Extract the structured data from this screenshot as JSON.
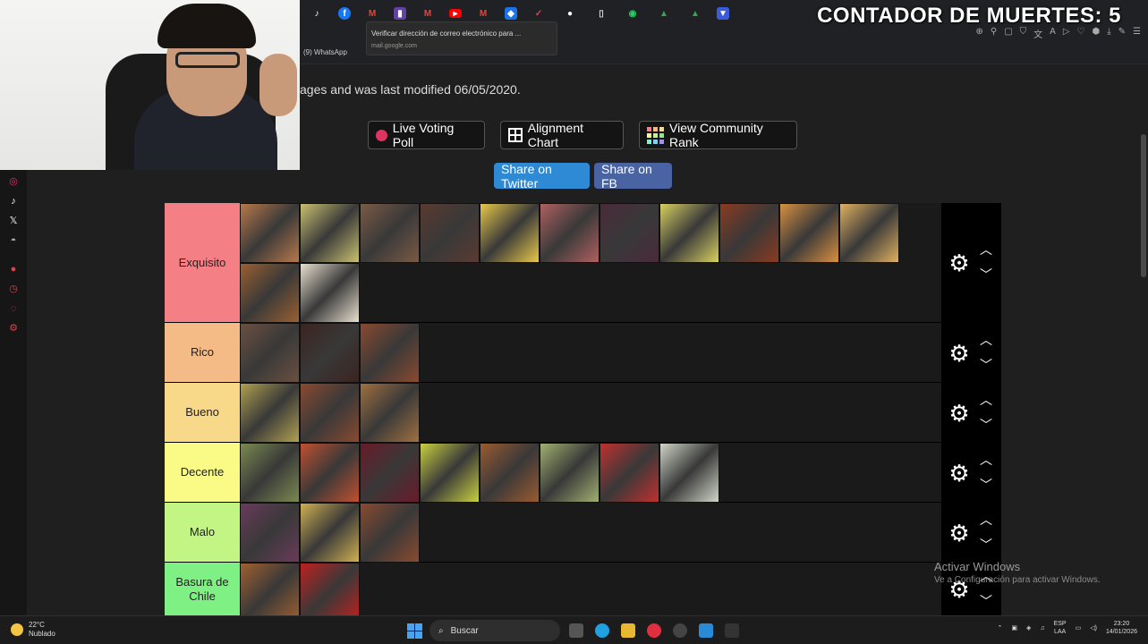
{
  "browser": {
    "counter": "CONTADOR DE MUERTES: 5",
    "tooltip_title": "Verificar dirección de correo electrónico para ...",
    "tooltip_url": "mail.google.com",
    "whatsapp_tab": "(9) WhatsApp"
  },
  "page": {
    "description": "ages and was last modified 06/05/2020.",
    "buttons": {
      "live_poll": "Live Voting Poll",
      "alignment": "Alignment Chart",
      "community": "View Community Rank",
      "twitter": "Share on Twitter",
      "facebook": "Share on FB"
    }
  },
  "tiers": [
    {
      "label": "Exquisito",
      "color": "#f47f85",
      "item_colors": [
        "#b8784a",
        "#c9c070",
        "#7a5a45",
        "#5a3a30",
        "#e8c84a",
        "#b06060",
        "#4a2a3a",
        "#d8d060",
        "#8a3a20",
        "#d89040",
        "#e0b060",
        "#9a6030",
        "#e8e0d0"
      ]
    },
    {
      "label": "Rico",
      "color": "#f5bb86",
      "item_colors": [
        "#6a5040",
        "#3a2420",
        "#8a4a30"
      ]
    },
    {
      "label": "Bueno",
      "color": "#f8d889",
      "item_colors": [
        "#b0a050",
        "#8a4a30",
        "#a07040"
      ]
    },
    {
      "label": "Decente",
      "color": "#fafa86",
      "item_colors": [
        "#7a8a50",
        "#c05030",
        "#6a1a2a",
        "#c8d040",
        "#9a5a30",
        "#a0b070",
        "#c03030",
        "#d0d4c8"
      ]
    },
    {
      "label": "Malo",
      "color": "#c3f585",
      "item_colors": [
        "#6a3a5a",
        "#d0b050",
        "#8a4a30"
      ]
    },
    {
      "label": "Basura de Chile",
      "color": "#7ff083",
      "item_colors": [
        "#a06030",
        "#c02020"
      ]
    }
  ],
  "watermark": {
    "title": "Activar Windows",
    "subtitle": "Ve a Configuración para activar Windows."
  },
  "taskbar": {
    "temp": "22°C",
    "weather": "Nublado",
    "search_label": "Buscar",
    "lang": "ESP",
    "lang2": "LAA",
    "time": "23:20",
    "date": "14/01/2026"
  }
}
